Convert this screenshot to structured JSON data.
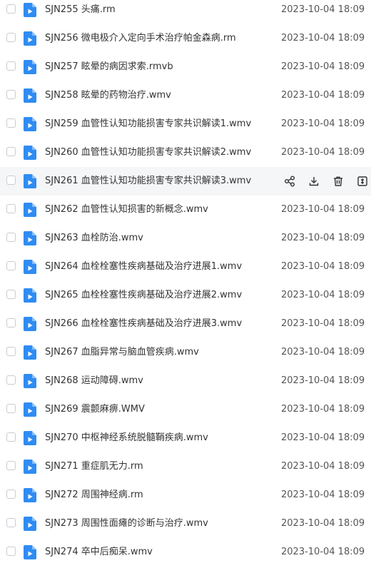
{
  "colors": {
    "accent": "#2f8cf4",
    "hover_row": "#f5f6f8",
    "text": "#333333",
    "icon": "#333333"
  },
  "icons": {
    "file": "video-file-icon",
    "actions": [
      "share-icon",
      "download-icon",
      "delete-icon",
      "more-icon"
    ]
  },
  "files": [
    {
      "name": "SJN255 头痛.rm",
      "date": "2023-10-04 18:09"
    },
    {
      "name": "SJN256 微电极介入定向手术治疗帕金森病.rm",
      "date": "2023-10-04 18:09"
    },
    {
      "name": "SJN257 眩晕的病因求索.rmvb",
      "date": "2023-10-04 18:09"
    },
    {
      "name": "SJN258 眩晕的药物治疗.wmv",
      "date": "2023-10-04 18:09"
    },
    {
      "name": "SJN259 血管性认知功能损害专家共识解读1.wmv",
      "date": "2023-10-04 18:09"
    },
    {
      "name": "SJN260 血管性认知功能损害专家共识解读2.wmv",
      "date": "2023-10-04 18:09"
    },
    {
      "name": "SJN261 血管性认知功能损害专家共识解读3.wmv",
      "date": "",
      "hovered": true
    },
    {
      "name": "SJN262 血管性认知损害的新概念.wmv",
      "date": "2023-10-04 18:09"
    },
    {
      "name": "SJN263 血栓防治.wmv",
      "date": "2023-10-04 18:09"
    },
    {
      "name": "SJN264 血栓栓塞性疾病基础及治疗进展1.wmv",
      "date": "2023-10-04 18:09"
    },
    {
      "name": "SJN265 血栓栓塞性疾病基础及治疗进展2.wmv",
      "date": "2023-10-04 18:09"
    },
    {
      "name": "SJN266 血栓栓塞性疾病基础及治疗进展3.wmv",
      "date": "2023-10-04 18:09"
    },
    {
      "name": "SJN267 血脂异常与脑血管疾病.wmv",
      "date": "2023-10-04 18:09"
    },
    {
      "name": "SJN268 运动障碍.wmv",
      "date": "2023-10-04 18:09"
    },
    {
      "name": "SJN269 震颤麻痹.WMV",
      "date": "2023-10-04 18:09"
    },
    {
      "name": "SJN270 中枢神经系统脱髓鞘疾病.wmv",
      "date": "2023-10-04 18:09"
    },
    {
      "name": "SJN271 重症肌无力.rm",
      "date": "2023-10-04 18:09"
    },
    {
      "name": "SJN272 周围神经病.rm",
      "date": "2023-10-04 18:09"
    },
    {
      "name": "SJN273 周围性面瘫的诊断与治疗.wmv",
      "date": "2023-10-04 18:09"
    },
    {
      "name": "SJN274 卒中后痴呆.wmv",
      "date": "2023-10-04 18:09"
    }
  ]
}
